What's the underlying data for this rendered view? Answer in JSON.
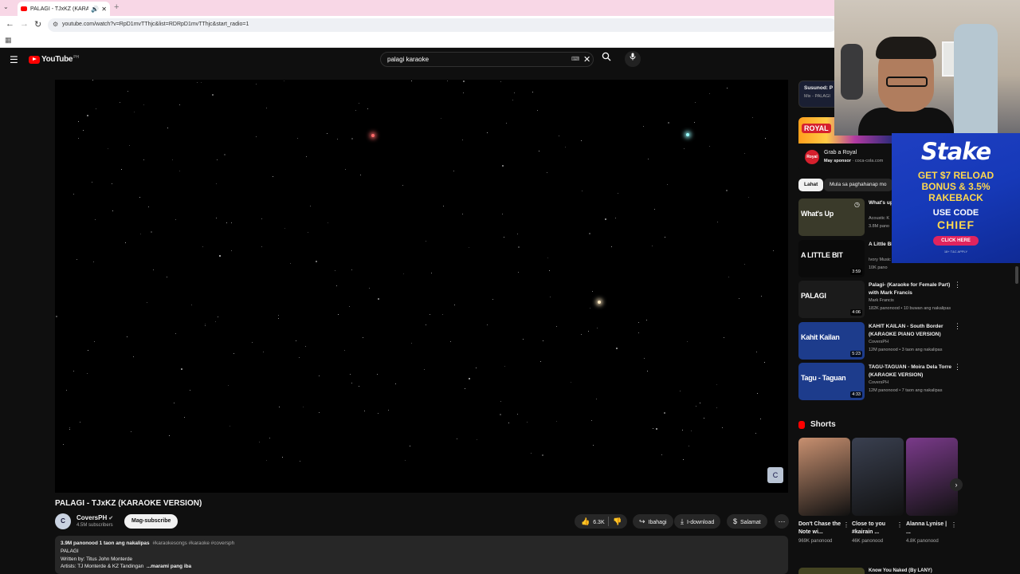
{
  "browser": {
    "tab_title": "PALAGI - TJxKZ (KARAOKE",
    "url": "youtube.com/watch?v=RpD1mvTThjc&list=RDRpD1mvTThjc&start_radio=1"
  },
  "header": {
    "logo_text": "YouTube",
    "country": "PH",
    "search_value": "palagi karaoke"
  },
  "video": {
    "title": "PALAGI - TJxKZ (KARAOKE VERSION)",
    "channel_name": "CoversPH",
    "channel_avatar_text": "C",
    "subscribers": "4.5M subscribers",
    "subscribe_label": "Mag-subscribe",
    "likes": "6.3K",
    "share_label": "Ibahagi",
    "download_label": "I-download",
    "thanks_label": "Salamat",
    "watermark_text": "C",
    "description": {
      "meta": "3.9M panonood  1 taon ang nakalipas",
      "tags": "#karaokesongs #karaoke #coversph",
      "line1": "PALAGI",
      "line2": "Written by: Titus John Monterde",
      "line3": "Artists: TJ Monterde & KZ Tandingan",
      "more": "...marami pang iba"
    }
  },
  "sidebar": {
    "next_up": {
      "label": "Susunod: P",
      "sub": "Mix - PALAGI"
    },
    "ad": {
      "title": "Grab a Royal",
      "sponsor_label": "May sponsor",
      "sponsor_domain": "coca-cola.com",
      "logo_text": "Royal",
      "banner_text": "ROYAL"
    },
    "chips": [
      {
        "label": "Lahat",
        "selected": true
      },
      {
        "label": "Mula sa paghahanap mo",
        "selected": false
      }
    ],
    "recommendations": [
      {
        "title": "What's up Non Blon",
        "channel": "Acoustic K",
        "meta": "3.8M pano",
        "duration": "",
        "thumb_text": "What's Up",
        "thumb_color": "#3a3a2a"
      },
      {
        "title": "A Little Bi",
        "channel": "Ivory Music",
        "meta": "10K pano",
        "duration": "3:59",
        "thumb_text": "A LITTLE BIT",
        "thumb_color": "#0a0a0a"
      },
      {
        "title": "Palagi- (Karaoke for Female Part) with Mark Francis",
        "channel": "Mark Francis",
        "meta": "182K panonood • 10 buwan ang nakalipas",
        "duration": "4:06",
        "thumb_text": "PALAGI",
        "thumb_color": "#1b1b1b"
      },
      {
        "title": "KAHIT KAILAN - South Border (KARAOKE PIANO VERSION)",
        "channel": "CoversPH",
        "meta": "12M panonood • 3 taon ang nakalipas",
        "duration": "5:23",
        "thumb_text": "Kahit Kailan",
        "thumb_color": "#1d3c8c"
      },
      {
        "title": "TAGU-TAGUAN - Moira Dela Torre (KARAOKE VERSION)",
        "channel": "CoversPH",
        "meta": "12M panonood • 7 taon ang nakalipas",
        "duration": "4:33",
        "thumb_text": "Tagu - Taguan",
        "thumb_color": "#1d3c8c"
      }
    ],
    "shorts": {
      "heading": "Shorts",
      "items": [
        {
          "title": "Don't Chase the Note wi...",
          "views": "969K panonood",
          "color": "#c89070"
        },
        {
          "title": "Close to you #kairain ...",
          "views": "46K panonood",
          "color": "#3a4050"
        },
        {
          "title": "Alanna Lynise | ...",
          "views": "4.8K panonood",
          "color": "#7a3a8a"
        }
      ]
    },
    "last_rec_title": "Know You Naked (By LANY)"
  },
  "overlay": {
    "brand": "Stake",
    "offer_line1": "GET $7 RELOAD",
    "offer_line2": "BONUS & 3.5%",
    "offer_line3": "RAKEBACK",
    "code_label": "USE CODE",
    "code": "CHIEF",
    "cta": "CLICK HERE",
    "fine_print": "18+ T&C APPLY"
  }
}
